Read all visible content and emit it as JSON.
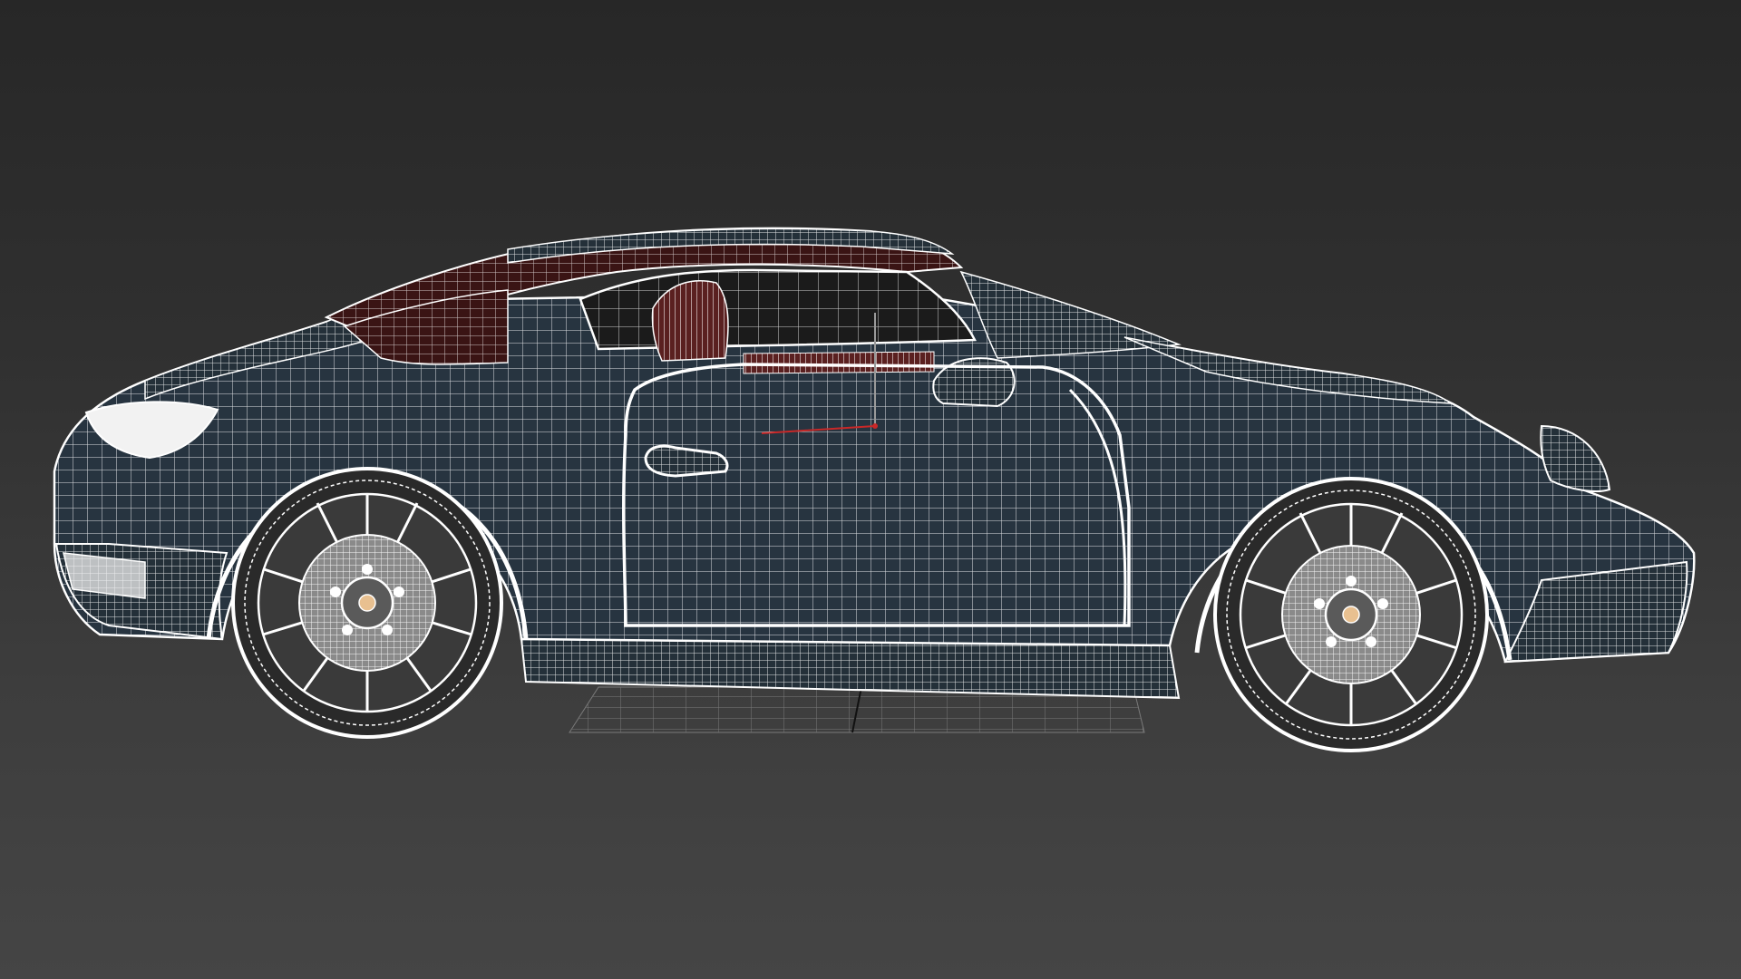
{
  "viewport": {
    "background_top": "#272727",
    "background_bottom": "#454545"
  },
  "model": {
    "body_color": "#273440",
    "body_color_dark": "#1f2a34",
    "interior_color": "#3a1414",
    "interior_seat_color": "#5a2020",
    "glass_color": "#1a1a1a",
    "wire_color": "#ffffff",
    "tire_color": "#2a2a2a",
    "rim_color": "#8e8e8e"
  },
  "ground_grid": {
    "color": "#7a7a7a",
    "axis_color": "#111111"
  },
  "gizmo": {
    "x_axis_color": "#c82828",
    "y_axis_color": "#9a9a9a"
  }
}
